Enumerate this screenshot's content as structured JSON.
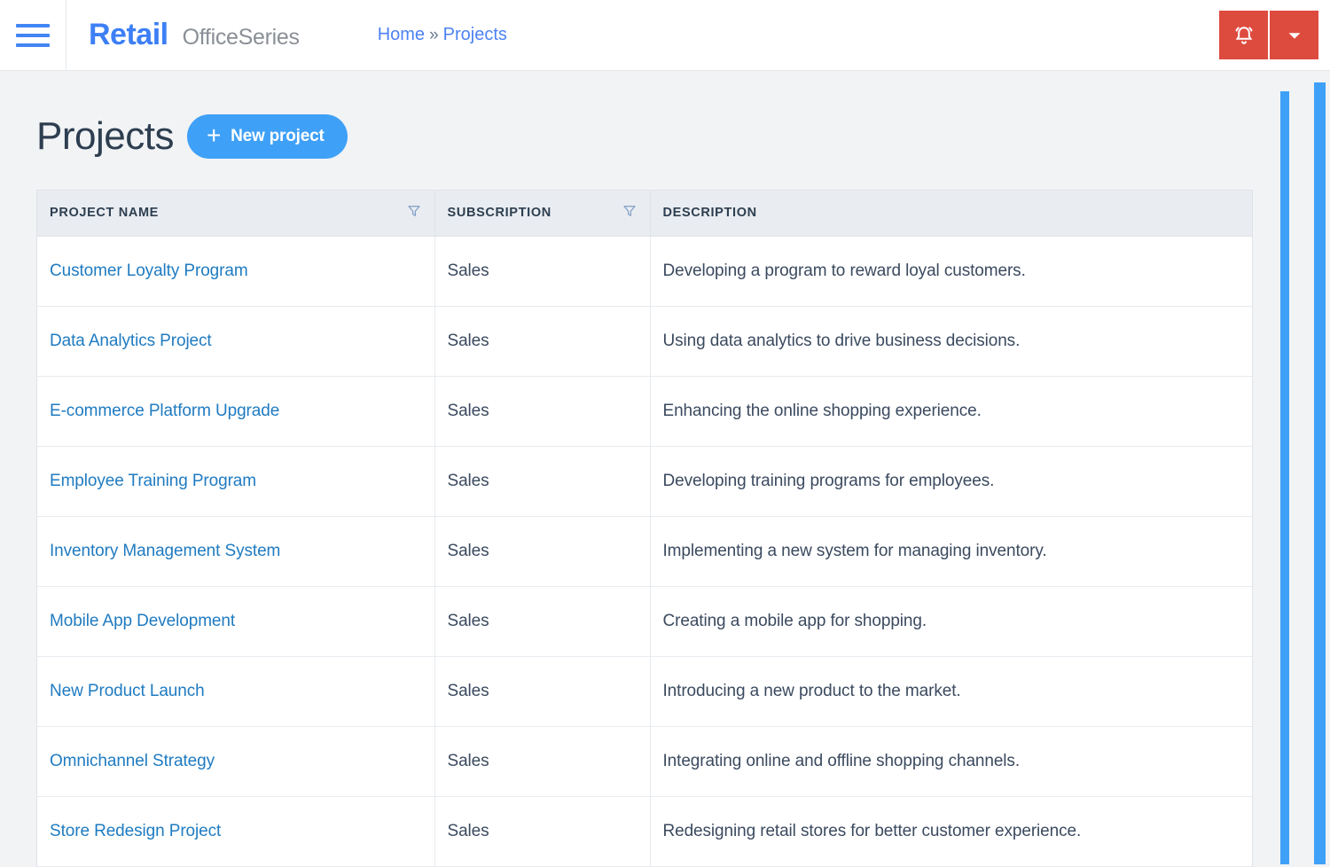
{
  "topbar": {
    "menu_icon": "hamburger-menu-icon",
    "brand_main": "Retail",
    "brand_sub": "OfficeSeries",
    "breadcrumb": {
      "home": "Home",
      "separator": "»",
      "current": "Projects"
    },
    "actions": {
      "notification_icon": "bell-icon",
      "dropdown_icon": "chevron-down-icon"
    },
    "accent_red": "#dd4b3e",
    "accent_blue": "#3d7ff5"
  },
  "page": {
    "title": "Projects",
    "new_project_label": "New project",
    "new_project_plus": "+",
    "accent_button": "#3fa0f7"
  },
  "table": {
    "columns": [
      {
        "label": "PROJECT NAME",
        "filterable": true
      },
      {
        "label": "SUBSCRIPTION",
        "filterable": true
      },
      {
        "label": "DESCRIPTION",
        "filterable": false
      }
    ],
    "rows": [
      {
        "name": "Customer Loyalty Program",
        "subscription": "Sales",
        "description": "Developing a program to reward loyal customers."
      },
      {
        "name": "Data Analytics Project",
        "subscription": "Sales",
        "description": "Using data analytics to drive business decisions."
      },
      {
        "name": "E-commerce Platform Upgrade",
        "subscription": "Sales",
        "description": "Enhancing the online shopping experience."
      },
      {
        "name": "Employee Training Program",
        "subscription": "Sales",
        "description": "Developing training programs for employees."
      },
      {
        "name": "Inventory Management System",
        "subscription": "Sales",
        "description": "Implementing a new system for managing inventory."
      },
      {
        "name": "Mobile App Development",
        "subscription": "Sales",
        "description": "Creating a mobile app for shopping."
      },
      {
        "name": "New Product Launch",
        "subscription": "Sales",
        "description": "Introducing a new product to the market."
      },
      {
        "name": "Omnichannel Strategy",
        "subscription": "Sales",
        "description": "Integrating online and offline shopping channels."
      },
      {
        "name": "Store Redesign Project",
        "subscription": "Sales",
        "description": "Redesigning retail stores for better customer experience."
      }
    ]
  },
  "scrollbars": {
    "page_scrollbar": "page-vertical-scrollbar",
    "inner_scrollbar": "content-vertical-scrollbar",
    "color": "#3fa0f7"
  }
}
